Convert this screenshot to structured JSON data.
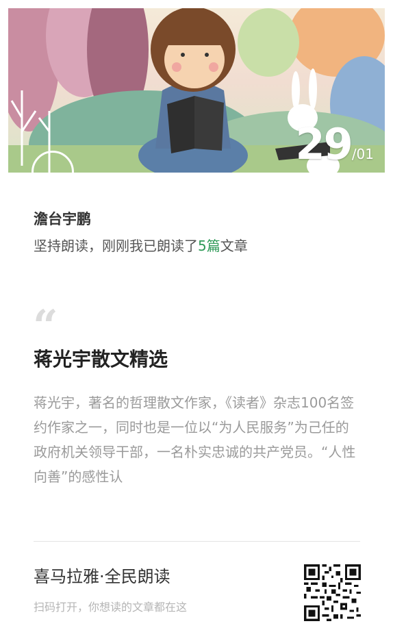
{
  "banner": {
    "date_day": "29",
    "date_month": "/01"
  },
  "user": {
    "name": "澹台宇鹏",
    "status_prefix": "坚持朗读，刚刚我已朗读了",
    "status_count": "5篇",
    "status_suffix": "文章"
  },
  "article": {
    "quote_mark": "“",
    "title": "蒋光宇散文精选",
    "description": "蒋光宇，著名的哲理散文作家，《读者》杂志100名签约作家之一，同时也是一位以“为人民服务”为己任的政府机关领导干部，一名朴实忠诚的共产党员。“人性向善”的感性认"
  },
  "footer": {
    "brand": "喜马拉雅·全民朗读",
    "hint": "扫码打开，你想读的文章都在这"
  },
  "colors": {
    "accent": "#2f9a58",
    "text_primary": "#333333",
    "text_muted": "#9a9a9a"
  }
}
